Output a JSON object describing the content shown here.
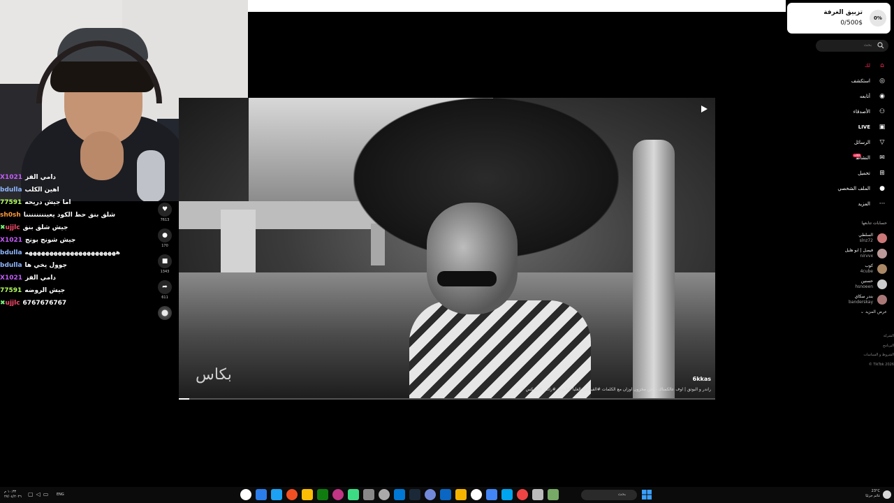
{
  "room_goal": {
    "title": "تزبيق الغرفة",
    "amount": "0/500$",
    "progress": "0%"
  },
  "chat": [
    {
      "user": "X1021",
      "user_color": "#c75cff",
      "message": "دامي الفز"
    },
    {
      "user": "bdulla",
      "user_color": "#8fb6ff",
      "message": "اهين الكلب"
    },
    {
      "user": "77591",
      "user_color": "#b3ff5a",
      "message": "اما جيش دريحه"
    },
    {
      "user": "sh0sh",
      "user_color": "#ff9a3c",
      "message": "شلق بنق حط الكود يعيننننننننا"
    },
    {
      "user": "ujjlc",
      "user_color": "#ff4d6d",
      "message": "جيش شلق بنق",
      "badge": "✖"
    },
    {
      "user": "X1021",
      "user_color": "#c75cff",
      "message": "جيش شونج بونج"
    },
    {
      "user": "bdulla",
      "user_color": "#8fb6ff",
      "message": "ههههههههههههههههههههههه"
    },
    {
      "user": "bdulla",
      "user_color": "#8fb6ff",
      "message": "جوول يخي ها"
    },
    {
      "user": "X1021",
      "user_color": "#c75cff",
      "message": "دامي الفز"
    },
    {
      "user": "77591",
      "user_color": "#b3ff5a",
      "message": "جيش الروضه"
    },
    {
      "user": "ujjlc",
      "user_color": "#ff4d6d",
      "message": "6767676767",
      "badge": "✖"
    }
  ],
  "actions": [
    {
      "icon": "heart-icon",
      "glyph": "♥",
      "count": "7613"
    },
    {
      "icon": "comment-icon",
      "glyph": "●",
      "count": "170"
    },
    {
      "icon": "bookmark-icon",
      "glyph": "■",
      "count": "1343"
    },
    {
      "icon": "share-icon",
      "glyph": "➦",
      "count": "611"
    }
  ],
  "video": {
    "watermark": "بكاس",
    "channel": "6kkas",
    "caption": "راندر و البوتق | اوف عالكمناك - احن مخزون اوزان مع الكلمات #القيادات_العليا #البوتق #راندر #ريمكس #راب",
    "progress": 0.02
  },
  "search": {
    "placeholder": "بحث"
  },
  "nav": [
    {
      "id": "foryou",
      "label": "لك",
      "glyph": "⌂",
      "active": true
    },
    {
      "id": "explore",
      "label": "استكشف",
      "glyph": "◎"
    },
    {
      "id": "following",
      "label": "أتابعه",
      "glyph": "◉"
    },
    {
      "id": "friends",
      "label": "الأصدقاء",
      "glyph": "⚇"
    },
    {
      "id": "live",
      "label": "LIVE",
      "glyph": "▣"
    },
    {
      "id": "messages",
      "label": "الرسائل",
      "glyph": "▽"
    },
    {
      "id": "activity",
      "label": "النشاط",
      "glyph": "✉",
      "badge": "99+"
    },
    {
      "id": "upload",
      "label": "تحميل",
      "glyph": "⊞"
    },
    {
      "id": "profile",
      "label": "الملف الشخصي",
      "glyph": "●"
    },
    {
      "id": "more",
      "label": "المزيد",
      "glyph": "···"
    }
  ],
  "following_title": "حسابات تتابعها",
  "following": [
    {
      "name": "السلطي",
      "handle": "slnz72",
      "color": "#c77"
    },
    {
      "name": "فيصل | ابو هليل",
      "handle": "nirvvx",
      "color": "#b99"
    },
    {
      "name": "كوب",
      "handle": "4cube",
      "color": "#a86"
    },
    {
      "name": "حسنين",
      "handle": "hsnoeen",
      "color": "#ccc"
    },
    {
      "name": "بندر سكاي",
      "handle": "banderskay",
      "color": "#a77"
    }
  ],
  "show_more": "عرض المزيد",
  "footer": [
    "الشركة",
    "البرنامج",
    "الشروط و السياسات",
    "© TikTok 2026"
  ],
  "taskbar": {
    "clock_time": "١٠:٣٣ م",
    "clock_date": "٢٧/٠٤/٢٠٢٦",
    "lang": "ENG",
    "search_placeholder": "بحث",
    "weather_temp": "23°C",
    "weather_desc": "غائم جزئيًا",
    "apps": [
      "#fff",
      "#2b7de9",
      "#1da1f2",
      "#f25022",
      "#fbbc05",
      "#107c10",
      "#c13584",
      "#3ddc84",
      "#888",
      "#aaa",
      "#0078d4",
      "#1b2838",
      "#7289da",
      "#0a66c2",
      "#f4b400",
      "#fff",
      "#4285f4",
      "#00a4ef",
      "#e44",
      "#bbb",
      "#7a6"
    ]
  }
}
